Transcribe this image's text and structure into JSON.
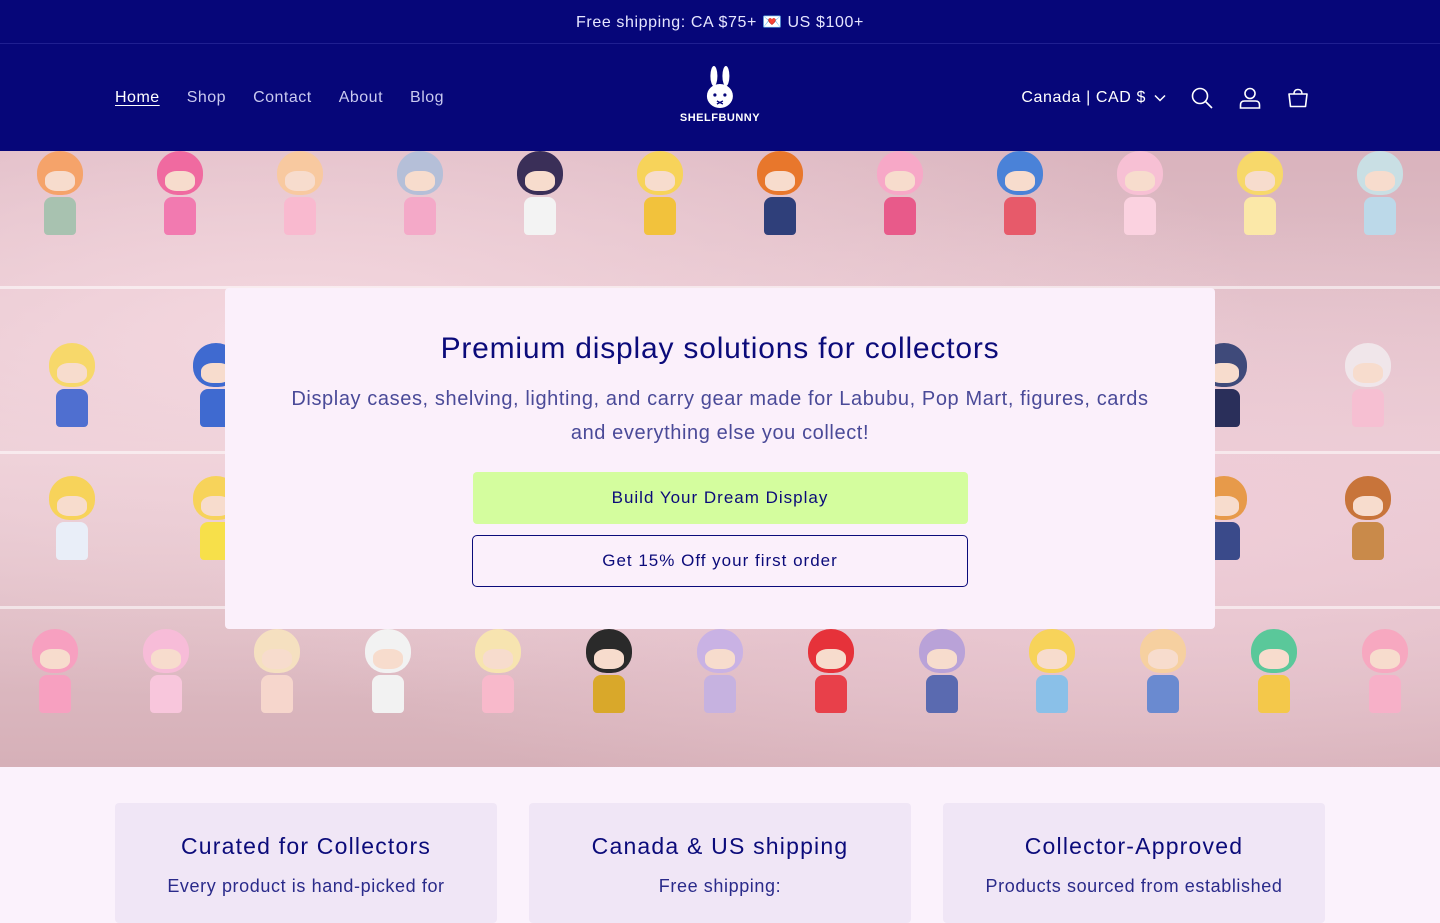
{
  "announcement": {
    "text": "Free shipping: CA $75+ 💌 US $100+"
  },
  "nav": {
    "items": [
      {
        "label": "Home",
        "active": true
      },
      {
        "label": "Shop"
      },
      {
        "label": "Contact"
      },
      {
        "label": "About"
      },
      {
        "label": "Blog"
      }
    ]
  },
  "logo": {
    "part1": "SHELF",
    "part2": "BUNNY"
  },
  "header_right": {
    "currency_label": "Canada | CAD $",
    "icons": [
      "chevron-down-icon",
      "search-icon",
      "account-icon",
      "cart-icon"
    ]
  },
  "hero": {
    "title": "Premium display solutions for collectors",
    "subtitle": "Display cases, shelving, lighting, and carry gear made for Labubu, Pop Mart, figures, cards and everything else you collect!",
    "primary_button": "Build Your Dream Display",
    "secondary_button": "Get 15% Off your first order"
  },
  "features": [
    {
      "title": "Curated for Collectors",
      "text": "Every product is hand-picked for"
    },
    {
      "title": "Canada & US shipping",
      "text": "Free shipping:"
    },
    {
      "title": "Collector-Approved",
      "text": "Products sourced from established"
    }
  ],
  "colors": {
    "header_bg": "#060679",
    "primary_button_bg": "#d4fd9e",
    "text_primary": "#0b0b7a",
    "card_bg": "#fbf0fb"
  }
}
